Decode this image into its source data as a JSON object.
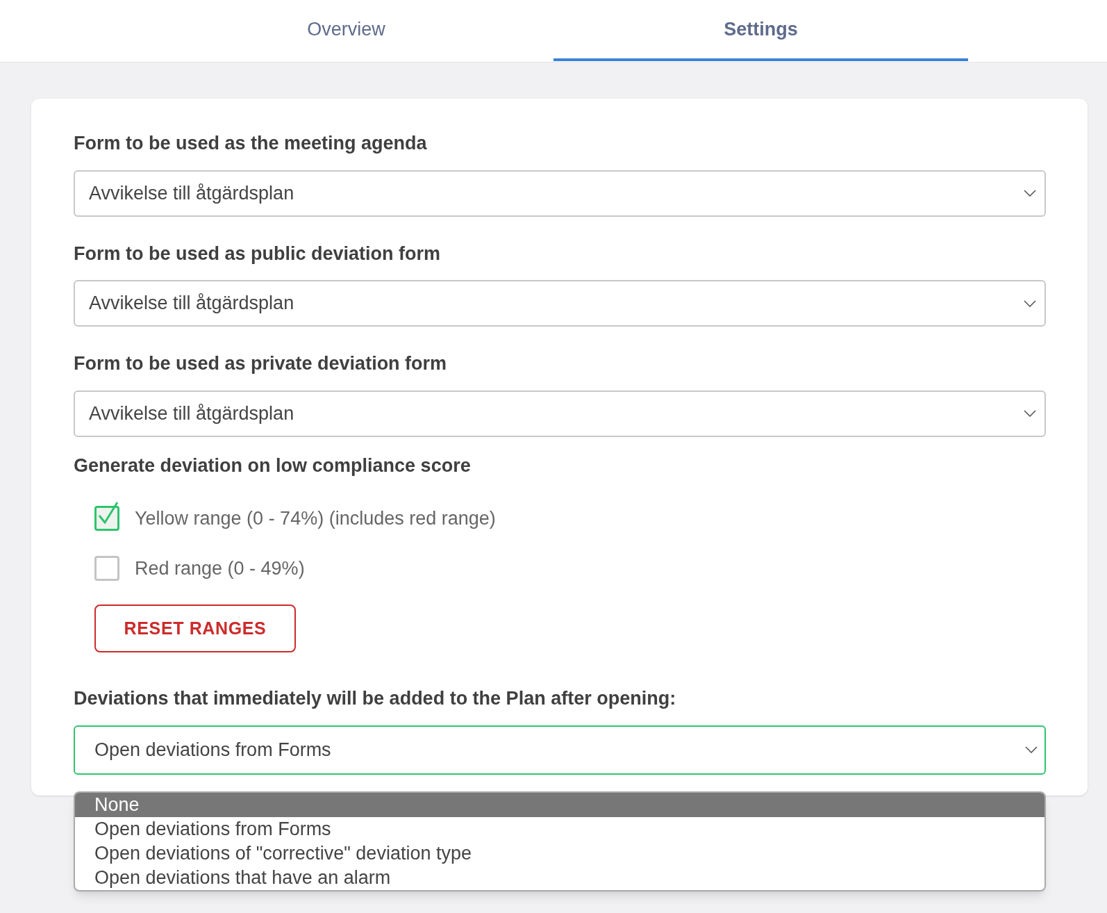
{
  "tabs": [
    {
      "label": "Overview",
      "selected": false
    },
    {
      "label": "Settings",
      "selected": true
    }
  ],
  "form_selects": [
    {
      "label": "Form to be used as the meeting agenda",
      "value": "Avvikelse till åtgärdsplan"
    },
    {
      "label": "Form to be used as public deviation form",
      "value": "Avvikelse till åtgärdsplan"
    },
    {
      "label": "Form to be used as private deviation form",
      "value": "Avvikelse till åtgärdsplan"
    }
  ],
  "compliance": {
    "heading": "Generate deviation on low compliance score",
    "options": [
      {
        "label": "Yellow range (0 - 74%) (includes red range)",
        "checked": true
      },
      {
        "label": "Red range (0 - 49%)",
        "checked": false
      }
    ],
    "reset_button": "RESET RANGES"
  },
  "plan_deviations": {
    "label": "Deviations that immediately will be added to the Plan after opening:",
    "value": "Open deviations from Forms",
    "expanded": true,
    "options": [
      {
        "label": "None",
        "highlighted": true
      },
      {
        "label": "Open deviations from Forms",
        "highlighted": false
      },
      {
        "label": "Open deviations of \"corrective\" deviation type",
        "highlighted": false
      },
      {
        "label": "Open deviations that have an alarm",
        "highlighted": false
      }
    ]
  }
}
